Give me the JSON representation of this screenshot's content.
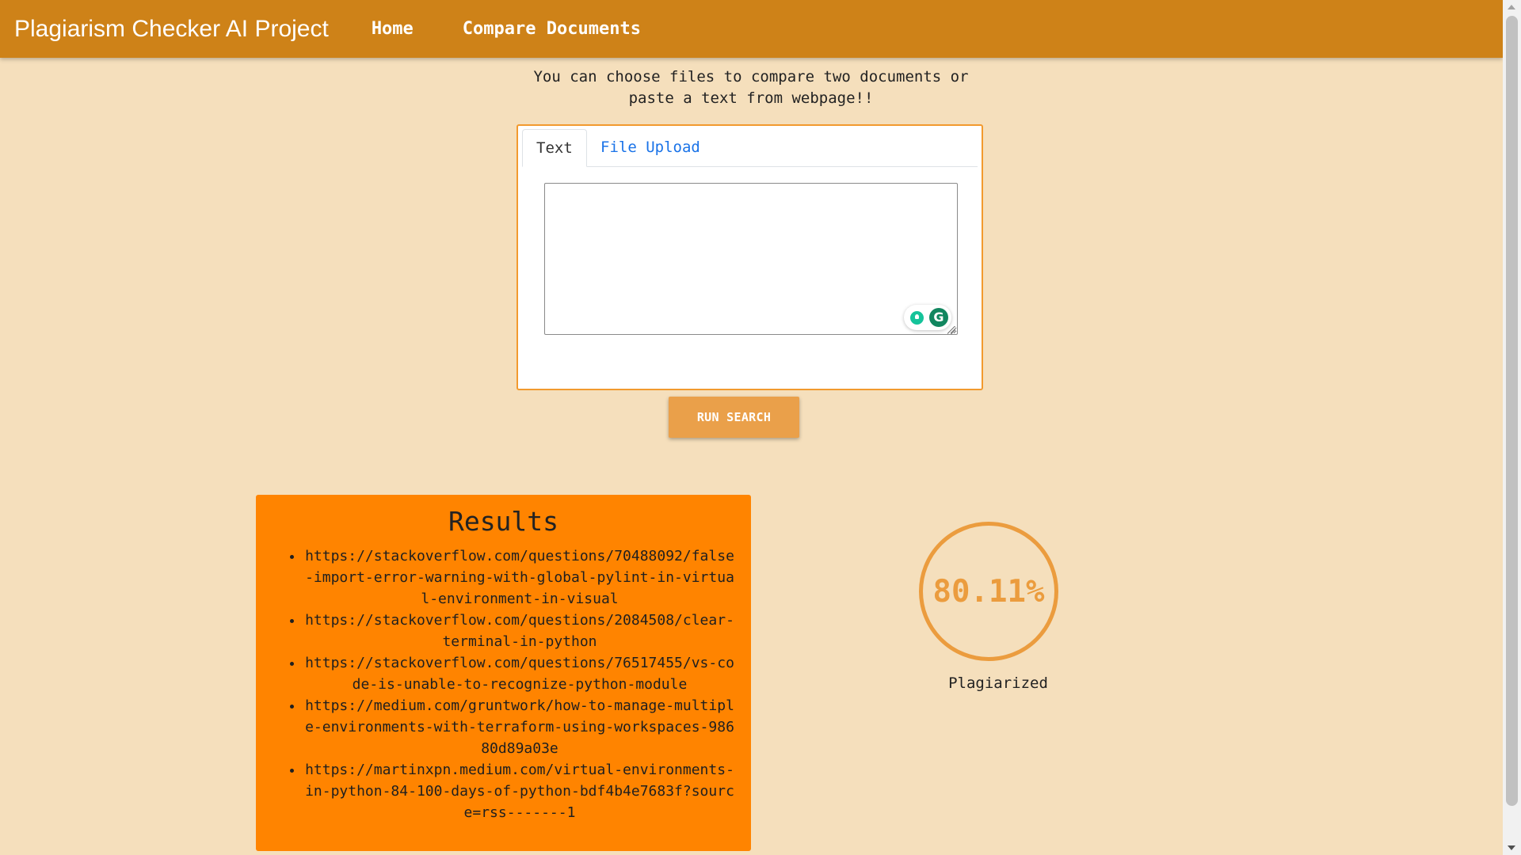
{
  "navbar": {
    "brand": "Plagiarism Checker AI Project",
    "links": {
      "home": "Home",
      "compare": "Compare Documents"
    }
  },
  "intro": "You can choose files to compare two documents or paste a text from webpage!!",
  "tabs": {
    "text_label": "Text",
    "upload_label": "File Upload",
    "active": "Text"
  },
  "textarea": {
    "value": ""
  },
  "grammarly": {
    "logo": "G"
  },
  "run_button": {
    "label": "RUN SEARCH"
  },
  "results": {
    "title": "Results",
    "links": [
      "https://stackoverflow.com/questions/70488092/false-import-error-warning-with-global-pylint-in-virtual-environment-in-visual",
      "https://stackoverflow.com/questions/2084508/clear-terminal-in-python",
      "https://stackoverflow.com/questions/76517455/vs-code-is-unable-to-recognize-python-module",
      "https://medium.com/gruntwork/how-to-manage-multiple-environments-with-terraform-using-workspaces-98680d89a03e",
      "https://martinxpn.medium.com/virtual-environments-in-python-84-100-days-of-python-bdf4b4e7683f?source=rss-------1"
    ]
  },
  "score": {
    "value": "80.11%",
    "label": "Plagiarized"
  },
  "colors": {
    "navbar": "#ce8218",
    "background": "#f5dfbc",
    "panel_border": "#f29a2e",
    "run_button": "#eaa04a",
    "results_bg": "#ff8400",
    "score": "#eb9c3e",
    "tab_link": "#1a73e8"
  }
}
